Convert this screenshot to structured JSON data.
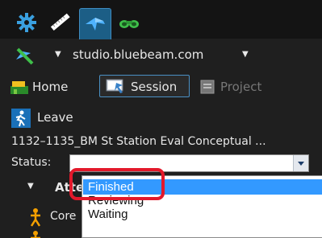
{
  "toolbar_tabs": [
    {
      "icon": "gear-icon",
      "active": false
    },
    {
      "icon": "measure-icon",
      "active": false
    },
    {
      "icon": "studio-icon",
      "active": true
    },
    {
      "icon": "binoculars-icon",
      "active": false
    }
  ],
  "server": {
    "label": "studio.bluebeam.com"
  },
  "nav": {
    "home": "Home",
    "session": "Session",
    "project": "Project"
  },
  "leave": {
    "label": "Leave"
  },
  "session_title": "1132–1135_BM St Station Eval Conceptual ...",
  "status": {
    "label": "Status:",
    "options": [
      "Finished",
      "Reviewing",
      "Waiting"
    ],
    "highlighted": "Finished"
  },
  "attendees": {
    "heading": "Atte",
    "items": [
      "Core"
    ]
  },
  "colors": {
    "accent": "#1c5e86",
    "highlight": "#3399ff",
    "callout": "#e3192b"
  }
}
